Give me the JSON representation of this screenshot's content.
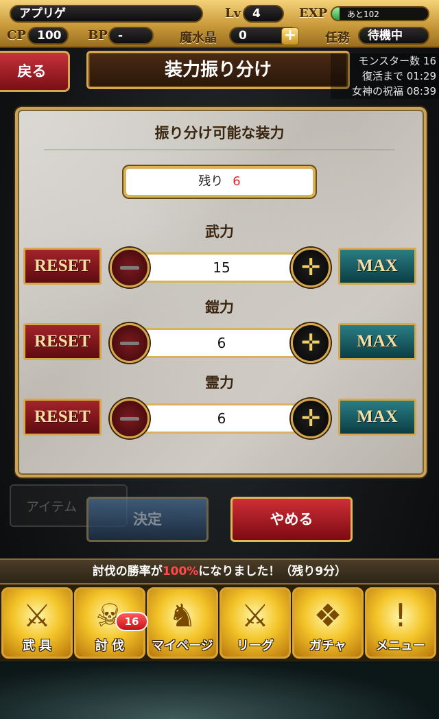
{
  "status_bar": {
    "player_name": "アプリゲ",
    "lv_label": "Lv",
    "lv_value": "4",
    "exp_label": "EXP",
    "exp_text": "あと102",
    "exp_progress": 0.08,
    "cp_label": "CP",
    "cp_value": "100",
    "bp_label": "BP",
    "bp_value": "-",
    "mana_label": "魔水晶",
    "mana_value": "0",
    "mission_label": "任務",
    "mission_value": "待機中"
  },
  "header": {
    "back_label": "戻る",
    "title": "装力振り分け",
    "monster_count": "モンスター数 16",
    "recovery": "復活まで 01:29",
    "goddess": "女神の祝福 08:39"
  },
  "panel": {
    "title": "振り分け可能な装力",
    "remain_label": "残り",
    "remain_value": "6",
    "reset_label": "RESET",
    "max_label": "MAX",
    "stats": [
      {
        "name": "武力",
        "value": "15"
      },
      {
        "name": "鎧力",
        "value": "6"
      },
      {
        "name": "霊力",
        "value": "6"
      }
    ]
  },
  "actions": {
    "item_ghost": "アイテム",
    "decide_label": "決定",
    "cancel_label": "やめる"
  },
  "notice": {
    "before": "討伐の勝率が",
    "highlight": "100%",
    "after": "になりました！（残り9分）"
  },
  "nav": {
    "items": [
      {
        "label": "武 具"
      },
      {
        "label": "討 伐"
      },
      {
        "label": "マイページ"
      },
      {
        "label": "リーグ"
      },
      {
        "label": "ガチャ"
      },
      {
        "label": "メニュー"
      }
    ],
    "hunt_badge": "16"
  }
}
